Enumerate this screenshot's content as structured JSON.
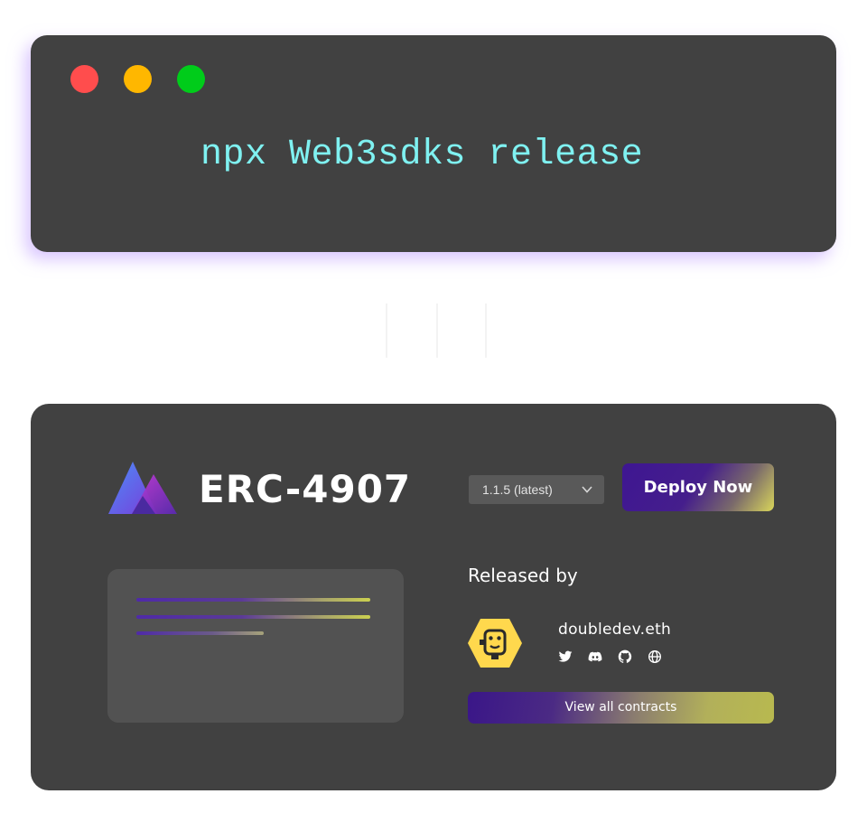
{
  "terminal": {
    "command": "npx Web3sdks release",
    "window_controls": [
      "close-dot",
      "minimize-dot",
      "maximize-dot"
    ],
    "colors": {
      "close": "#ff4d4d",
      "minimize": "#ffb700",
      "maximize": "#00cc1a",
      "command": "#7ff1f1",
      "background": "#414141"
    }
  },
  "release_card": {
    "logo_icon": "triangle-logo-icon",
    "title": "ERC-4907",
    "version_select": {
      "selected": "1.1.5 (latest)",
      "icon": "chevron-down-icon"
    },
    "deploy_button": "Deploy Now",
    "released_by": {
      "heading": "Released by",
      "username": "doubledev.eth",
      "avatar_icon": "robot-avatar-icon",
      "socials": [
        "twitter-icon",
        "discord-icon",
        "github-icon",
        "globe-icon"
      ]
    },
    "view_all_button": "View all contracts",
    "colors": {
      "background": "#414141",
      "panel": "#525252",
      "avatar": "#ffd84d",
      "accent_start": "#3e1692",
      "accent_end": "#d9d65a"
    }
  }
}
